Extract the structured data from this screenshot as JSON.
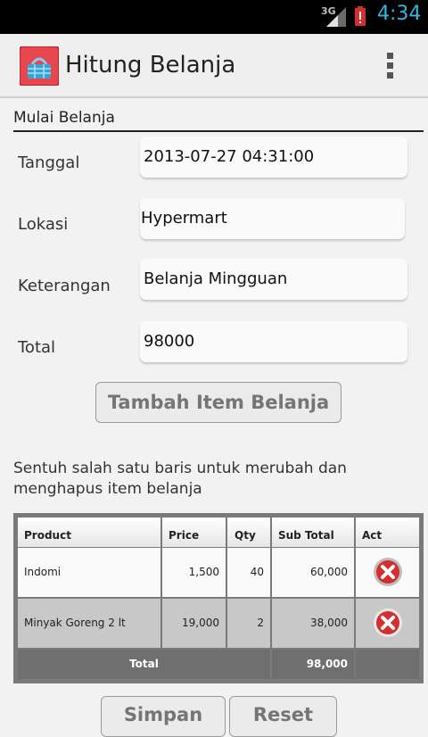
{
  "status_bar": {
    "network": "3G",
    "time": "4:34"
  },
  "app": {
    "title": "Hitung Belanja",
    "icon": "basket-icon",
    "menu_icon": "overflow-menu-icon"
  },
  "section": {
    "title": "Mulai Belanja"
  },
  "form": {
    "date": {
      "label": "Tanggal",
      "value": "2013-07-27 04:31:00"
    },
    "location": {
      "label": "Lokasi",
      "value": "Hypermart"
    },
    "notes": {
      "label": "Keterangan",
      "value": "Belanja Mingguan"
    },
    "total": {
      "label": "Total",
      "value": "98000"
    }
  },
  "add_item_button": "Tambah Item Belanja",
  "hint": "Sentuh salah satu baris untuk merubah dan menghapus item belanja",
  "table": {
    "headers": {
      "product": "Product",
      "price": "Price",
      "qty": "Qty",
      "subtotal": "Sub Total",
      "act": "Act"
    },
    "rows": [
      {
        "product": "Indomi",
        "price": "1,500",
        "qty": "40",
        "subtotal": "60,000"
      },
      {
        "product": "Minyak Goreng 2 lt",
        "price": "19,000",
        "qty": "2",
        "subtotal": "38,000"
      }
    ],
    "total_label": "Total",
    "total_value": "98,000"
  },
  "bottom_buttons": {
    "save": "Simpan",
    "reset": "Reset"
  },
  "colors": {
    "accent": "#33b5e5",
    "delete": "#d32f2f"
  }
}
